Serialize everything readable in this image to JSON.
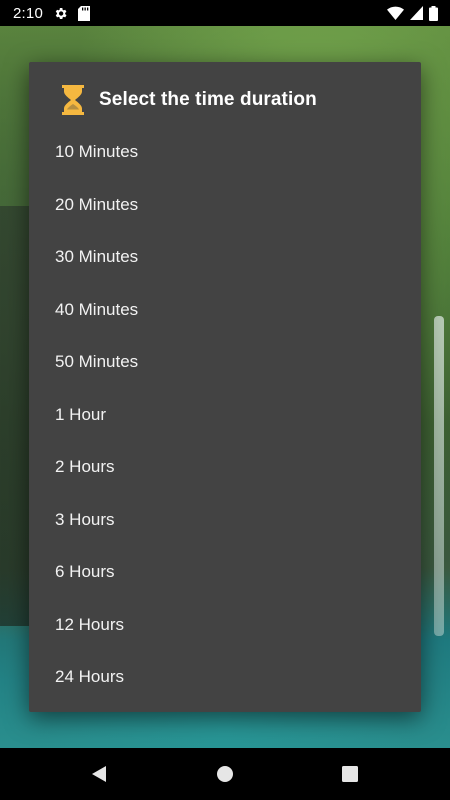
{
  "status_bar": {
    "time": "2:10",
    "icons": [
      "gear-icon",
      "sd-card-icon",
      "wifi-icon",
      "signal-icon",
      "battery-icon"
    ]
  },
  "dialog": {
    "title": "Select the time duration",
    "icon": "hourglass-icon",
    "icon_color": "#F5B840",
    "options": [
      "10 Minutes",
      "20 Minutes",
      "30 Minutes",
      "40 Minutes",
      "50 Minutes",
      "1 Hour",
      "2 Hours",
      "3 Hours",
      "6 Hours",
      "12 Hours",
      "24 Hours"
    ]
  },
  "nav_bar": {
    "buttons": [
      "back-icon",
      "home-icon",
      "recents-icon"
    ]
  }
}
